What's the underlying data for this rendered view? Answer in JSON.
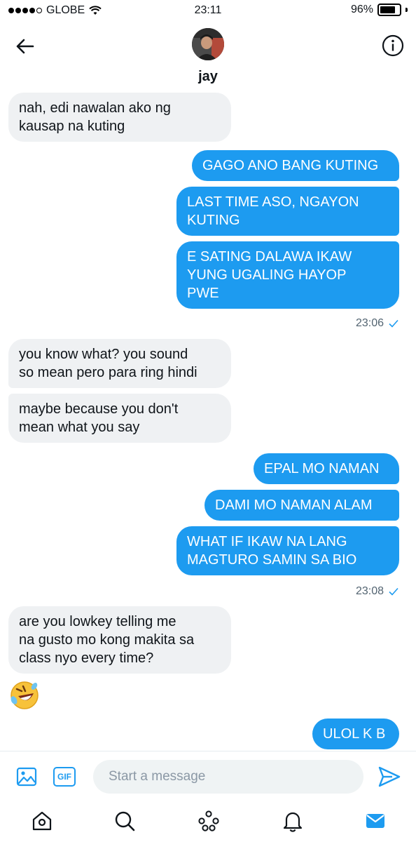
{
  "status_bar": {
    "carrier": "GLOBE",
    "time": "23:11",
    "battery": "96%",
    "battery_level": 0.96
  },
  "header": {
    "contact_name": "jay",
    "back_icon": "arrow-left-icon",
    "info_icon": "info-icon"
  },
  "messages": [
    {
      "dir": "in",
      "text": "nah, edi nawalan ako ng\nkausap na kuting"
    },
    {
      "dir": "out",
      "text": "GAGO ANO BANG KUTING"
    },
    {
      "dir": "out",
      "text": "LAST TIME ASO, NGAYON\nKUTING"
    },
    {
      "dir": "out",
      "text": "E SATING DALAWA IKAW\nYUNG UGALING HAYOP\nPWE"
    },
    {
      "dir": "in",
      "text": "you know what? you sound\nso mean pero para ring hindi"
    },
    {
      "dir": "in",
      "text": "maybe because you don't\nmean what you say"
    },
    {
      "dir": "out",
      "text": "EPAL MO NAMAN"
    },
    {
      "dir": "out",
      "text": "DAMI MO NAMAN ALAM"
    },
    {
      "dir": "out",
      "text": "WHAT IF IKAW NA LANG\nMAGTURO SAMIN SA BIO"
    },
    {
      "dir": "in",
      "text": "are you lowkey telling me\nna gusto mo kong makita sa\nclass nyo every time?"
    },
    {
      "dir": "out",
      "text": "ULOL K B"
    }
  ],
  "timestamps": [
    {
      "time": "23:06",
      "status_icon": "checkmark-icon"
    },
    {
      "time": "23:08",
      "status_icon": "checkmark-icon"
    }
  ],
  "reaction_emoji": "rolling-on-floor-laughing-emoji",
  "compose": {
    "placeholder": "Start a message",
    "gif_label": "GIF",
    "media_icon": "image-icon",
    "send_icon": "send-icon"
  },
  "tabbar": {
    "items": [
      "home-icon",
      "search-icon",
      "spaces-icon",
      "notifications-icon",
      "messages-icon"
    ],
    "active": "messages-icon"
  },
  "colors": {
    "accent": "#1d9bf0",
    "incoming_bubble": "#eff1f3",
    "text": "#0f1419",
    "muted": "#536471"
  }
}
